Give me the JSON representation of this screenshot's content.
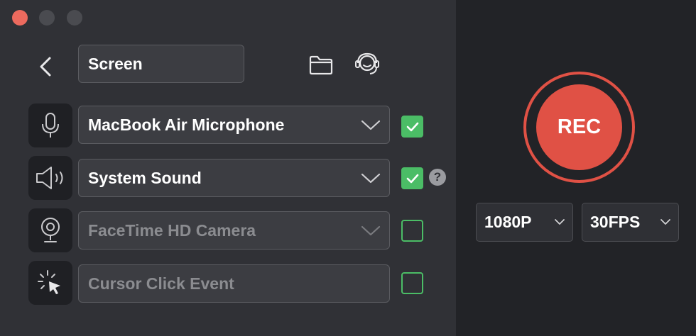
{
  "window": {
    "colors": {
      "close": "#ec6a5e",
      "inactive": "#4a4b50",
      "accent_green": "#4bbd66",
      "rec_red": "#e05145"
    }
  },
  "header": {
    "back_icon": "chevron-left-icon",
    "mode_value": "Screen",
    "folder_icon": "folder-icon",
    "support_icon": "headset-support-icon"
  },
  "sources": [
    {
      "icon": "microphone-icon",
      "label": "MacBook Air Microphone",
      "enabled": true,
      "has_dropdown": true
    },
    {
      "icon": "speaker-icon",
      "label": "System Sound",
      "enabled": true,
      "has_dropdown": true,
      "help": "?"
    },
    {
      "icon": "webcam-icon",
      "label": "FaceTime HD Camera",
      "enabled": false,
      "has_dropdown": true
    },
    {
      "icon": "cursor-click-icon",
      "label": "Cursor Click Event",
      "enabled": false,
      "has_dropdown": false
    }
  ],
  "record": {
    "button_label": "REC",
    "resolution": "1080P",
    "framerate": "30FPS"
  }
}
